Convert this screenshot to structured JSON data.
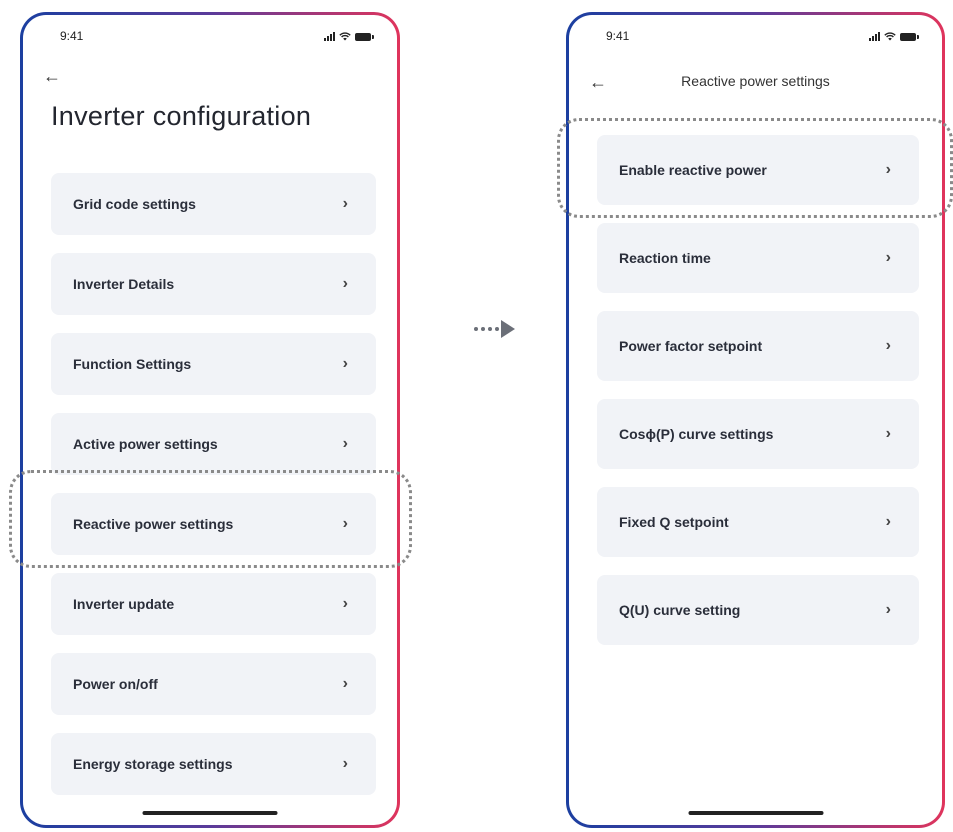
{
  "left_screen": {
    "status_time": "9:41",
    "back_icon": "back-arrow-icon",
    "title": "Inverter configuration",
    "items": [
      {
        "label": "Grid code settings",
        "chevron": "›"
      },
      {
        "label": "Inverter Details",
        "chevron": "›"
      },
      {
        "label": "Function Settings",
        "chevron": "›"
      },
      {
        "label": "Active power settings",
        "chevron": "›"
      },
      {
        "label": "Reactive power settings",
        "chevron": "›"
      },
      {
        "label": "Inverter update",
        "chevron": "›"
      },
      {
        "label": "Power on/off",
        "chevron": "›"
      },
      {
        "label": "Energy storage settings",
        "chevron": "›"
      }
    ],
    "highlighted_item": "Reactive power settings"
  },
  "right_screen": {
    "status_time": "9:41",
    "back_icon": "back-arrow-icon",
    "title": "Reactive power  settings",
    "items": [
      {
        "label": "Enable reactive power",
        "chevron": "›"
      },
      {
        "label": "Reaction time",
        "chevron": "›"
      },
      {
        "label": "Power factor setpoint",
        "chevron": "›"
      },
      {
        "label": "Cosϕ(P) curve settings",
        "chevron": "›"
      },
      {
        "label": "Fixed Q setpoint",
        "chevron": "›"
      },
      {
        "label": "Q(U) curve setting",
        "chevron": "›"
      }
    ],
    "highlighted_item": "Enable reactive power"
  },
  "colors": {
    "frame_gradient_start": "#1b3fa0",
    "frame_gradient_end": "#e0345c",
    "card_background": "#f1f3f7",
    "flow_arrow": "#6b6f78"
  }
}
